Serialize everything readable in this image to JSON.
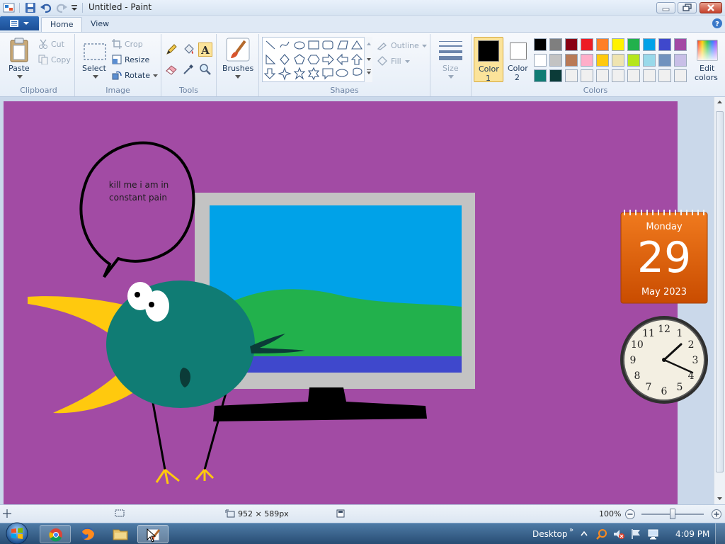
{
  "window": {
    "title": "Untitled - Paint"
  },
  "tabs": [
    {
      "label": "Home"
    },
    {
      "label": "View"
    }
  ],
  "ribbon": {
    "clipboard": {
      "label": "Clipboard",
      "paste": "Paste",
      "cut": "Cut",
      "copy": "Copy"
    },
    "image": {
      "label": "Image",
      "select": "Select",
      "crop": "Crop",
      "resize": "Resize",
      "rotate": "Rotate"
    },
    "tools": {
      "label": "Tools"
    },
    "brushes": {
      "label": "Brushes"
    },
    "shapes": {
      "label": "Shapes",
      "outline": "Outline",
      "fill": "Fill"
    },
    "size": {
      "label": "Size"
    },
    "colors": {
      "label": "Colors",
      "color1_line1": "Color",
      "color1_line2": "1",
      "color2_line1": "Color",
      "color2_line2": "2",
      "edit_line1": "Edit",
      "edit_line2": "colors",
      "color1": "#000000",
      "color2": "#ffffff",
      "palette_row1": [
        "#000000",
        "#7f7f7f",
        "#880015",
        "#ed1c24",
        "#ff7f27",
        "#fff200",
        "#22b14c",
        "#00a2e8",
        "#3f48cc",
        "#a349a4"
      ],
      "palette_row2": [
        "#ffffff",
        "#c3c3c3",
        "#b97a57",
        "#ffaec9",
        "#ffc90e",
        "#efe4b0",
        "#b5e61d",
        "#99d9ea",
        "#7092be",
        "#c8bfe7"
      ],
      "palette_row3": [
        "#107c74",
        "#0b3b38",
        "#f0f0f0",
        "#f0f0f0",
        "#f0f0f0",
        "#f0f0f0",
        "#f0f0f0",
        "#f0f0f0",
        "#f0f0f0",
        "#f0f0f0"
      ]
    }
  },
  "canvas": {
    "speech_line1": "kill me i am in",
    "speech_line2": "constant pain"
  },
  "statusbar": {
    "dimensions": "952 × 589px",
    "zoom": "100%"
  },
  "gadgets": {
    "calendar": {
      "weekday": "Monday",
      "day": "29",
      "month_year": "May 2023"
    },
    "clock": {
      "numbers": [
        "12",
        "1",
        "2",
        "3",
        "4",
        "5",
        "6",
        "7",
        "8",
        "9",
        "10",
        "11"
      ]
    }
  },
  "taskbar": {
    "desktop_label": "Desktop",
    "time": "4:09 PM"
  },
  "icons": {
    "start": "windows-orb-icon",
    "chrome": "chrome-icon",
    "firefox": "firefox-icon",
    "explorer": "folder-icon",
    "paint": "paint-icon"
  }
}
